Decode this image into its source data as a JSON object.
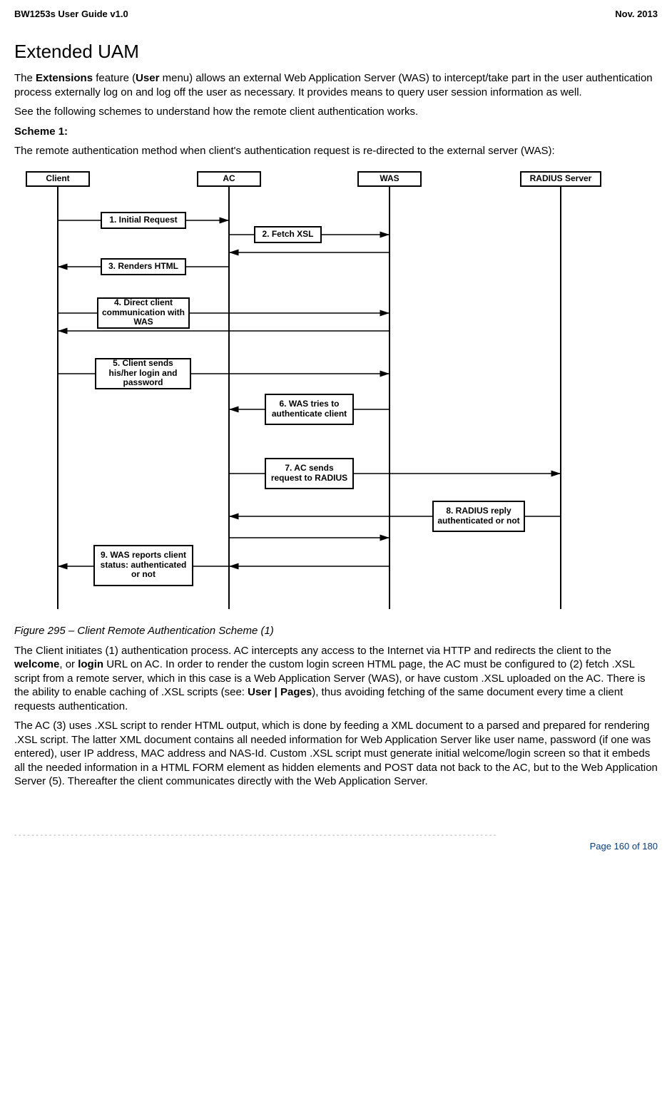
{
  "header": {
    "left": "BW1253s User Guide v1.0",
    "right": "Nov.  2013"
  },
  "title": "Extended UAM",
  "p1a": "The ",
  "p1b": "Extensions",
  "p1c": " feature (",
  "p1d": "User",
  "p1e": " menu) allows an external Web Application Server (WAS) to intercept/take part in the user authentication process externally log on and log off the user as necessary. It provides means to query user session information as well.",
  "p2": "See the following schemes to understand how the remote client authentication works.",
  "p3": "Scheme 1:",
  "p4": "The remote authentication method when client's authentication request is re-directed to the external server (WAS):",
  "diagram": {
    "client": "Client",
    "ac": "AC",
    "was": "WAS",
    "radius": "RADIUS Server",
    "s1": "1. Initial Request",
    "s2": "2. Fetch XSL",
    "s3": "3. Renders HTML",
    "s4": "4. Direct client communication with WAS",
    "s5": "5. Client sends his/her login and password",
    "s6": "6. WAS tries to authenticate client",
    "s7": "7. AC sends request to RADIUS",
    "s8": "8. RADIUS reply authenticated or not",
    "s9": "9. WAS reports client status: authenticated or not"
  },
  "figcap": "Figure 295  – Client Remote Authentication Scheme (1)",
  "p5a": "The Client initiates (1) authentication process. AC intercepts any access to the Internet via HTTP and redirects the client to the ",
  "p5b": "welcome",
  "p5c": ", or ",
  "p5d": "login",
  "p5e": " URL on AC. In order to render the custom login screen HTML page, the AC must be configured to (2) fetch .XSL script from a remote server, which in this case is a Web Application Server (WAS), or have custom .XSL uploaded on the AC. There is the ability to enable caching of .XSL scripts (see: ",
  "p5f": "User | Pages",
  "p5g": "), thus avoiding fetching of the same document every time a client requests authentication.",
  "p6": "The AC (3) uses .XSL script to render HTML output, which is done by feeding a XML document to a parsed and prepared for rendering .XSL script. The latter XML document contains all needed information for Web Application Server like user name, password (if one was entered), user IP address, MAC address and NAS-Id. Custom .XSL script must generate initial welcome/login screen so that it embeds all the needed information in a HTML FORM element as hidden elements and POST data not back to the AC, but to the Web Application Server (5). Thereafter the client communicates directly with the Web Application Server.",
  "footer": {
    "page": "Page 160 of 180"
  }
}
